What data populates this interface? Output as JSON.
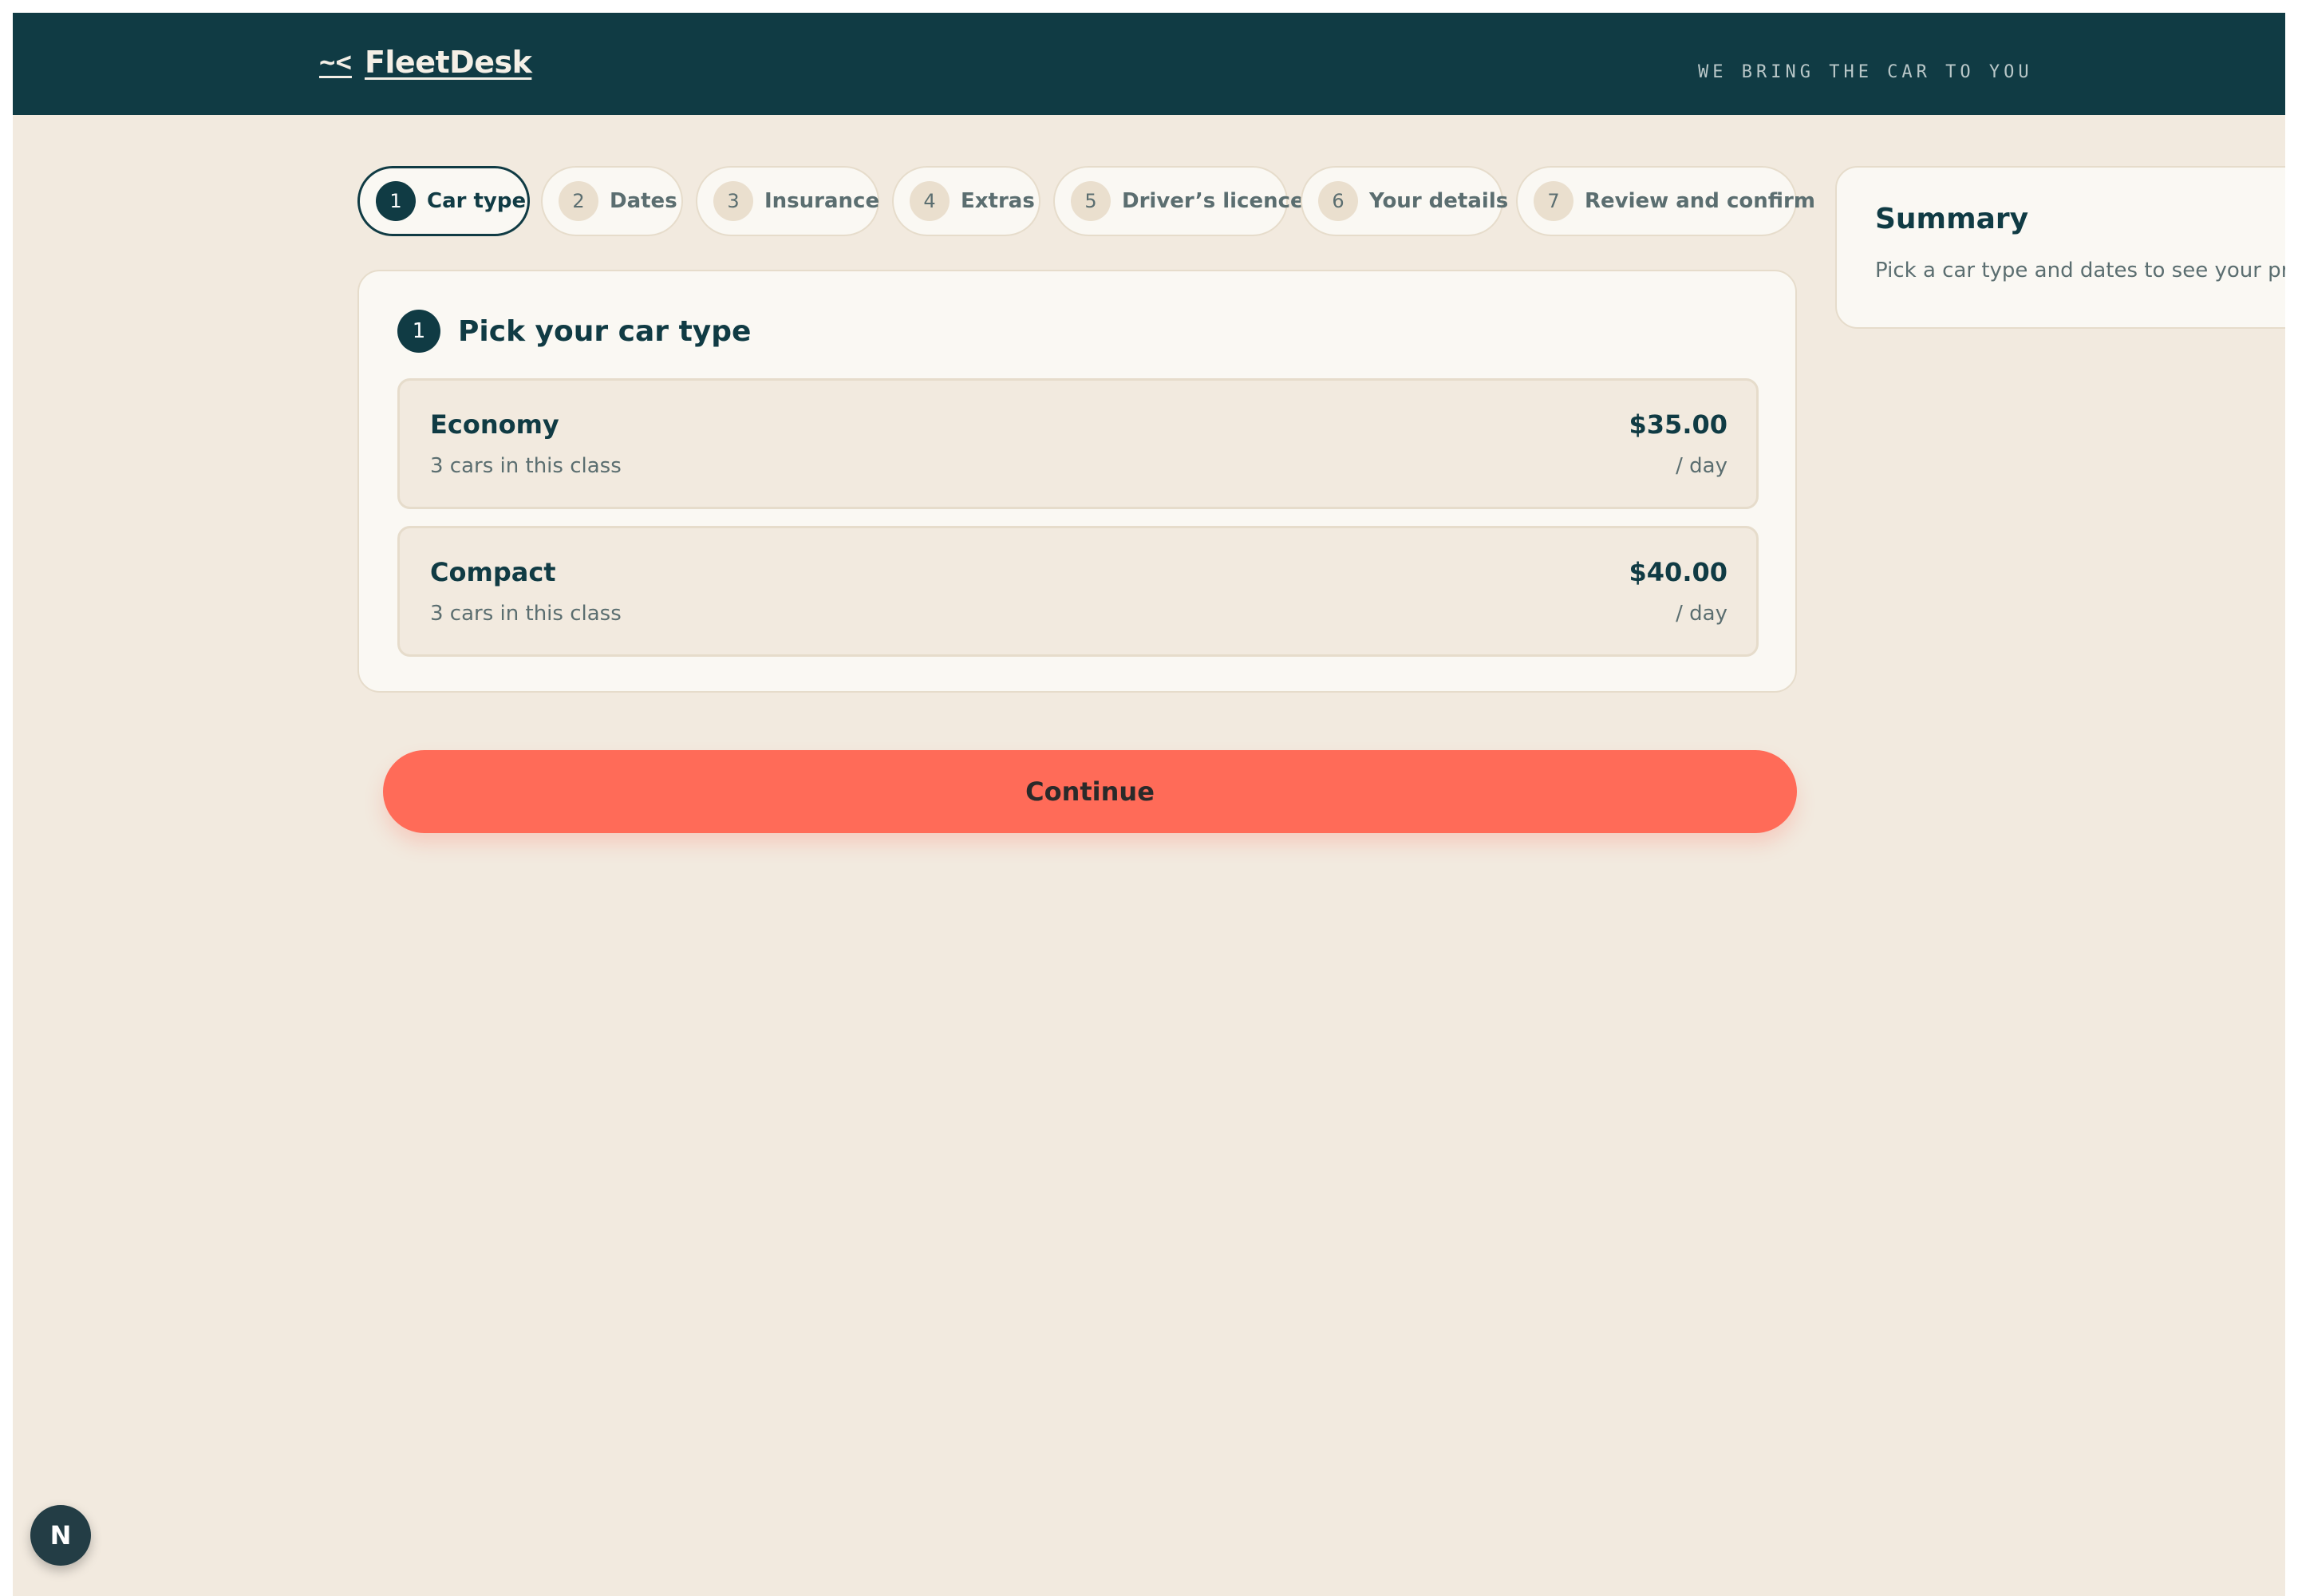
{
  "header": {
    "logo_mark": "~<",
    "brand": "FleetDesk",
    "tagline": "WE BRING THE CAR TO YOU"
  },
  "steps": [
    {
      "num": "1",
      "label": "Car type",
      "active": true
    },
    {
      "num": "2",
      "label": "Dates"
    },
    {
      "num": "3",
      "label": "Insurance"
    },
    {
      "num": "4",
      "label": "Extras"
    },
    {
      "num": "5",
      "label": "Driver’s licence"
    },
    {
      "num": "6",
      "label": "Your details"
    },
    {
      "num": "7",
      "label": "Review and confirm"
    }
  ],
  "card": {
    "num": "1",
    "title": "Pick your car type",
    "options": [
      {
        "name": "Economy",
        "sub": "3 cars in this class",
        "price": "$35.00",
        "unit": "/ day"
      },
      {
        "name": "Compact",
        "sub": "3 cars in this class",
        "price": "$40.00",
        "unit": "/ day"
      }
    ]
  },
  "continue_label": "Continue",
  "summary": {
    "title": "Summary",
    "text": "Pick a car type and dates to see your price."
  },
  "fab_label": "N",
  "colors": {
    "header_bg": "#103b44",
    "page_bg": "#f2eadf",
    "accent": "#ff6b58",
    "text_dark": "#103b44"
  }
}
